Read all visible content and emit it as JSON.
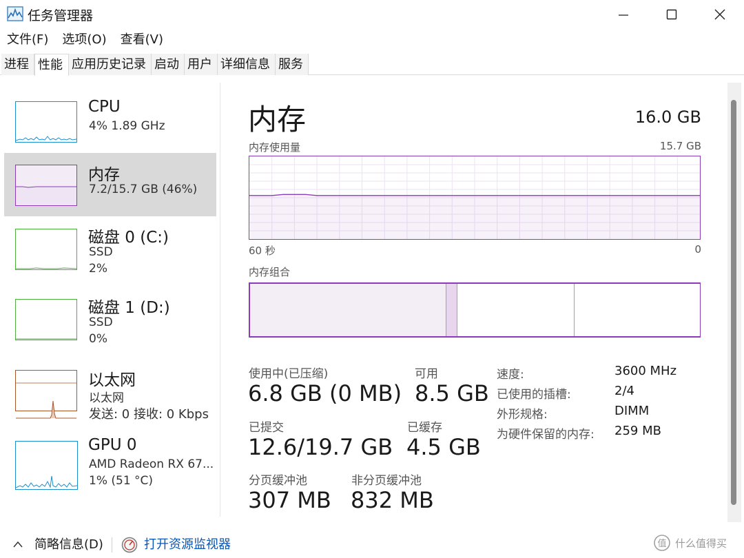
{
  "window": {
    "title": "任务管理器",
    "icon": "task-manager-icon"
  },
  "menu": [
    "文件(F)",
    "选项(O)",
    "查看(V)"
  ],
  "tabs": [
    "进程",
    "性能",
    "应用历史记录",
    "启动",
    "用户",
    "详细信息",
    "服务"
  ],
  "active_tab": "性能",
  "sidebar": {
    "items": [
      {
        "title": "CPU",
        "line1": "4%  1.89 GHz",
        "line2": "",
        "color": "#1a8fd0"
      },
      {
        "title": "内存",
        "line1": "7.2/15.7 GB (46%)",
        "line2": "",
        "color": "#8b3bb8"
      },
      {
        "title": "磁盘 0 (C:)",
        "line1": "SSD",
        "line2": "2%",
        "color": "#4caf3c"
      },
      {
        "title": "磁盘 1 (D:)",
        "line1": "SSD",
        "line2": "0%",
        "color": "#4caf3c"
      },
      {
        "title": "以太网",
        "line1": "以太网",
        "line2": "发送: 0 接收: 0 Kbps",
        "color": "#a8572a"
      },
      {
        "title": "GPU 0",
        "line1": "AMD Radeon RX 67...",
        "line2": "1% (51 °C)",
        "color": "#1a8fd0"
      }
    ]
  },
  "main": {
    "title": "内存",
    "total": "16.0 GB",
    "usage_label": "内存使用量",
    "usage_max": "15.7 GB",
    "time_left": "60 秒",
    "time_right": "0",
    "usage_fraction": 0.46,
    "composition_label": "内存组合",
    "composition": {
      "in_use": 0.435,
      "modified": 0.026,
      "standby": 0.26,
      "free": 0.279
    },
    "stats": {
      "in_use_label": "使用中(已压缩)",
      "in_use_value": "6.8 GB (0 MB)",
      "available_label": "可用",
      "available_value": "8.5 GB",
      "committed_label": "已提交",
      "committed_value": "12.6/19.7 GB",
      "cached_label": "已缓存",
      "cached_value": "4.5 GB",
      "paged_label": "分页缓冲池",
      "paged_value": "307 MB",
      "nonpaged_label": "非分页缓冲池",
      "nonpaged_value": "832 MB"
    },
    "props": [
      {
        "label": "速度:",
        "value": "3600 MHz"
      },
      {
        "label": "已使用的插槽:",
        "value": "2/4"
      },
      {
        "label": "外形规格:",
        "value": "DIMM"
      },
      {
        "label": "为硬件保留的内存:",
        "value": "259 MB"
      }
    ]
  },
  "footer": {
    "summary": "简略信息(D)",
    "resource_monitor": "打开资源监视器"
  },
  "watermark": "什么值得买"
}
